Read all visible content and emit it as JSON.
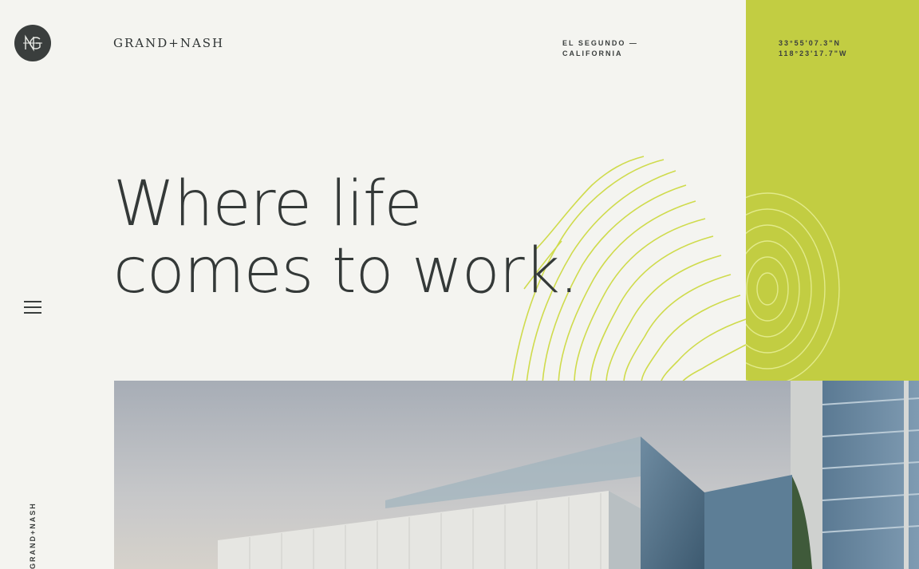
{
  "brand": {
    "name": "GRAND+NASH",
    "logo_label": "GN monogram"
  },
  "location": {
    "line1": "EL SEGUNDO —",
    "line2": "CALIFORNIA"
  },
  "coordinates": {
    "lat": "33°55'07.3\"N",
    "lng": "118°23'17.7\"W"
  },
  "hero": {
    "line1": "Where life",
    "line2": "comes to work."
  },
  "menu": {
    "icon": "hamburger-menu-icon"
  },
  "side_label": "GRAND+NASH",
  "colors": {
    "accent_green": "#c2cd42",
    "background": "#f4f4f0",
    "dark": "#3a3e3d"
  }
}
